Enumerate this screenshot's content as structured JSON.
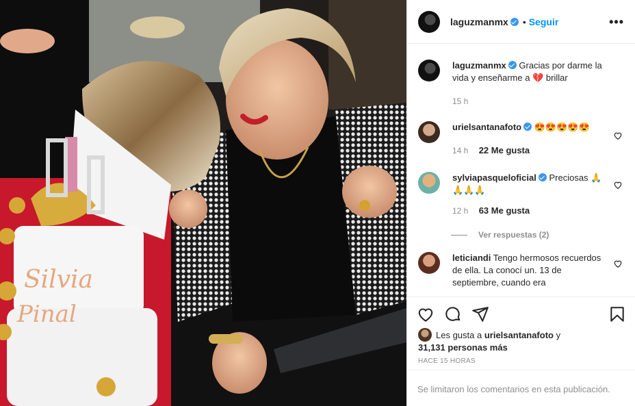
{
  "photo": {
    "alt": ""
  },
  "header": {
    "username": "laguzmanmx",
    "separator": "•",
    "follow_label": "Seguir",
    "more_label": "•••"
  },
  "caption": {
    "username": "laguzmanmx",
    "text_part1": "Gracias por darme la vida y enseñarme a",
    "emoji": "💔",
    "text_part2": "brillar",
    "time": "15 h"
  },
  "comments": [
    {
      "username": "urielsantanafoto",
      "verified": true,
      "text": "😍😍😍😍😍",
      "time": "14 h",
      "likes": "22 Me gusta"
    },
    {
      "username": "sylviapasqueloficial",
      "verified": true,
      "text": "Preciosas 🙏🙏🙏🙏",
      "time": "12 h",
      "likes": "63 Me gusta",
      "replies": "Ver respuestas (2)"
    },
    {
      "username": "leticiandi",
      "verified": false,
      "text": "Tengo hermosos recuerdos de ella. La conocí un. 13 de septiembre, cuando era"
    }
  ],
  "actions": {
    "like": "heart-icon",
    "comment": "comment-icon",
    "share": "share-icon",
    "save": "bookmark-icon"
  },
  "likes": {
    "prefix": "Les gusta a",
    "user": "urielsantanafoto",
    "middle": "y",
    "count": "31,131 personas más"
  },
  "timestamp": "HACE 15 HORAS",
  "footer_note": "Se limitaron los comentarios en esta publicación.",
  "colors": {
    "accent": "#0095f6",
    "verified": "#3897f0",
    "muted": "#8e8e8e",
    "text": "#262626",
    "border": "#efefef"
  }
}
